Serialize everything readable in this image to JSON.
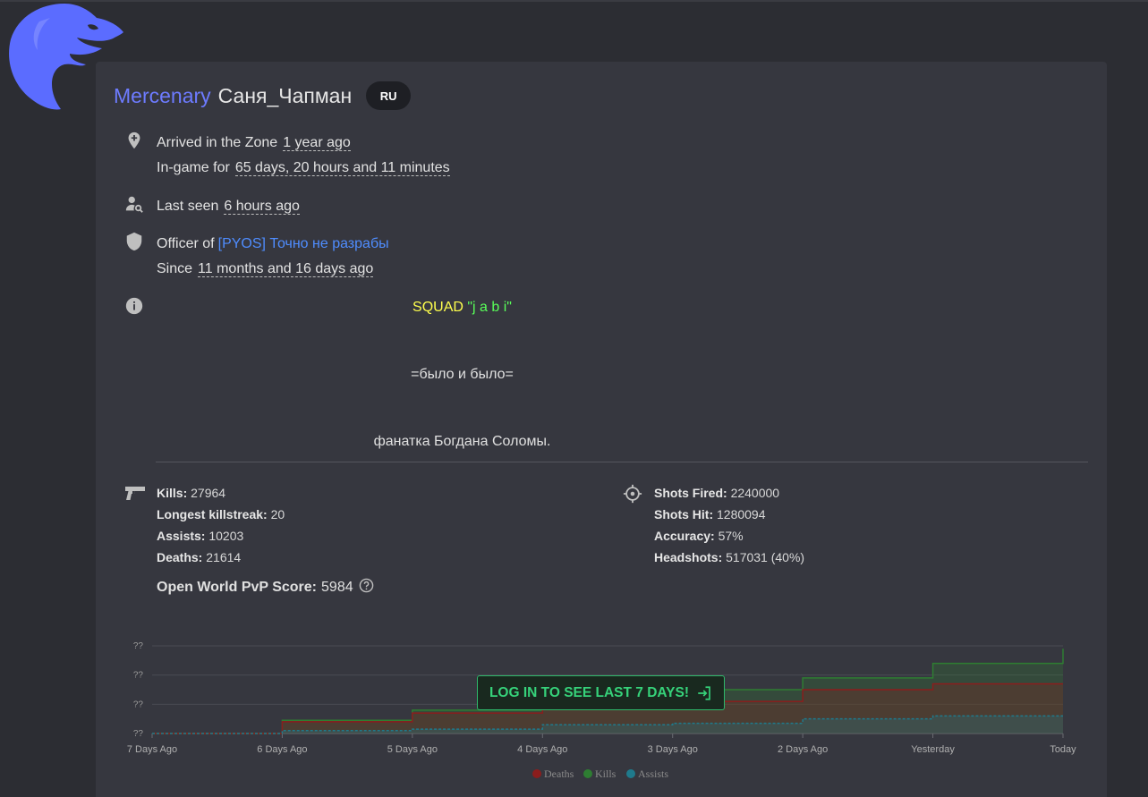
{
  "profile": {
    "rank": "Mercenary",
    "name": "Саня_Чапман",
    "region": "RU"
  },
  "info": {
    "arrived_label": "Arrived in the Zone",
    "arrived_value": "1 year ago",
    "ingame_label": "In-game for",
    "ingame_value": "65 days, 20 hours and 11 minutes",
    "lastseen_label": "Last seen",
    "lastseen_value": "6 hours ago",
    "officer_label": "Officer of",
    "clan": "[PYOS] Точно не разрабы",
    "since_label": "Since",
    "since_value": "11 months and 16 days ago"
  },
  "bio": {
    "squad_word": "SQUAD",
    "squad_name": "\"j a b i\"",
    "line2": "=было и было=",
    "line3": "фанатка Богдана Соломы."
  },
  "combat": {
    "kills_label": "Kills:",
    "kills": "27964",
    "streak_label": "Longest killstreak:",
    "streak": "20",
    "assists_label": "Assists:",
    "assists": "10203",
    "deaths_label": "Deaths:",
    "deaths": "21614"
  },
  "shooting": {
    "fired_label": "Shots Fired:",
    "fired": "2240000",
    "hit_label": "Shots Hit:",
    "hit": "1280094",
    "accuracy_label": "Accuracy:",
    "accuracy": "57%",
    "headshots_label": "Headshots:",
    "headshots": "517031 (40%)"
  },
  "pvp": {
    "label": "Open World PvP Score:",
    "value": "5984"
  },
  "login_button": "LOG IN TO SEE LAST 7 DAYS!",
  "icons": {
    "location": "map-pin-plus-icon",
    "lastseen": "user-search-icon",
    "officer": "shield-icon",
    "info": "info-icon",
    "kills": "pistol-icon",
    "shooting": "crosshair-icon",
    "help": "help-circle-icon",
    "login": "login-arrow-icon"
  },
  "colors": {
    "rank": "#6d7bff",
    "link": "#4f8dff",
    "deaths": "#8b1d1d",
    "kills": "#2e7d32",
    "assists": "#1f7a8c",
    "login_accent": "#36d27a"
  },
  "chart_data": {
    "type": "area",
    "categories": [
      "7 Days Ago",
      "6 Days Ago",
      "5 Days Ago",
      "4 Days Ago",
      "3 Days Ago",
      "2 Days Ago",
      "Yesterday",
      "Today"
    ],
    "ytick_labels": [
      "??",
      "??",
      "??",
      "??"
    ],
    "series": [
      {
        "name": "Deaths",
        "values": [
          0,
          0.4,
          0.7,
          0.9,
          1.1,
          1.5,
          1.7,
          1.7
        ]
      },
      {
        "name": "Kills",
        "values": [
          0,
          0.45,
          0.8,
          1.0,
          1.5,
          1.9,
          2.4,
          2.9
        ]
      },
      {
        "name": "Assists",
        "values": [
          0,
          0.1,
          0.15,
          0.3,
          0.35,
          0.5,
          0.6,
          0.6
        ]
      }
    ],
    "ylim": [
      0,
      3
    ],
    "grid": true,
    "legend": "bottom"
  }
}
